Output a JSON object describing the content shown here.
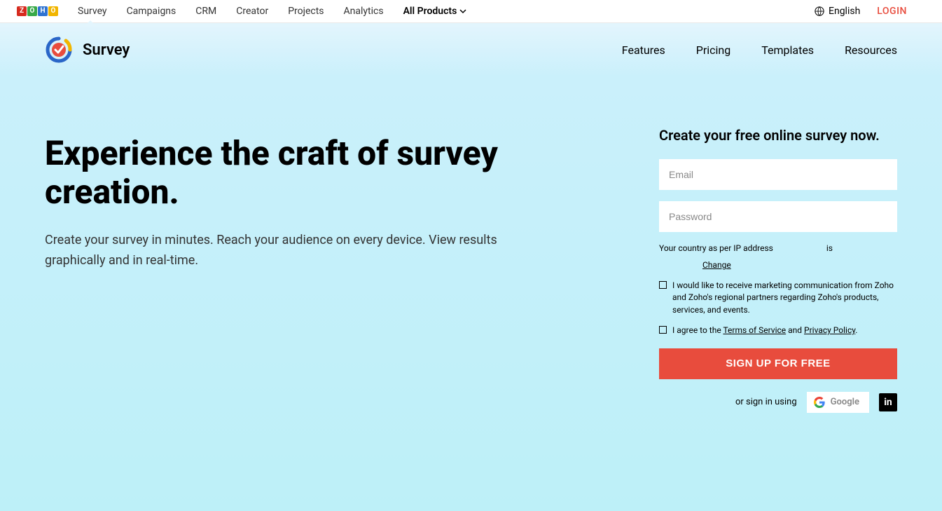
{
  "global_nav": {
    "logo_letters": [
      {
        "letter": "Z",
        "color": "#d62b1f"
      },
      {
        "letter": "O",
        "color": "#38a948"
      },
      {
        "letter": "H",
        "color": "#2f73d1"
      },
      {
        "letter": "O",
        "color": "#f1b500"
      }
    ],
    "links": [
      "Survey",
      "Campaigns",
      "CRM",
      "Creator",
      "Projects",
      "Analytics"
    ],
    "all_products_label": "All Products",
    "language_label": "English",
    "login_label": "LOGIN"
  },
  "product_bar": {
    "name": "Survey",
    "nav": [
      "Features",
      "Pricing",
      "Templates",
      "Resources"
    ]
  },
  "hero": {
    "title": "Experience the craft of survey creation.",
    "subtitle": "Create your survey in minutes. Reach your audience on every device. View results graphically and in real-time."
  },
  "signup": {
    "title": "Create your free online survey now.",
    "email_placeholder": "Email",
    "password_placeholder": "Password",
    "ip_text_prefix": "Your country as per IP address",
    "ip_text_suffix": "is",
    "change_label": "Change",
    "marketing_text": "I would like to receive marketing communication from Zoho and Zoho's regional partners regarding Zoho's products, services, and events.",
    "agree_prefix": "I agree to the ",
    "tos_label": "Terms of Service",
    "agree_middle": " and ",
    "privacy_label": "Privacy Policy",
    "agree_suffix": ".",
    "submit_label": "SIGN UP FOR FREE",
    "alt_text": "or sign in using",
    "google_label": "Google",
    "linkedin_label": "in"
  }
}
